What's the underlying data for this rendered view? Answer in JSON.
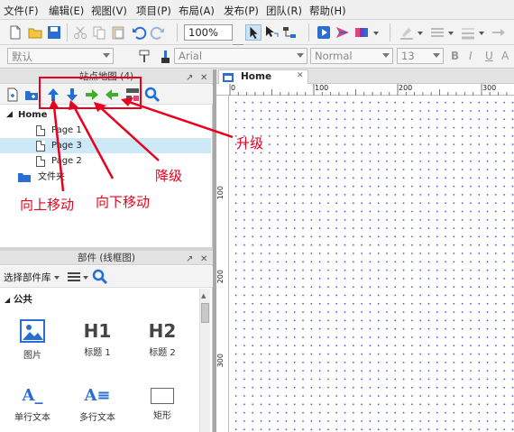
{
  "menu": {
    "items": [
      "文件(F)",
      "编辑(E)",
      "视图(V)",
      "项目(P)",
      "布局(A)",
      "发布(P)",
      "团队(R)",
      "帮助(H)"
    ]
  },
  "toolbar": {
    "zoom": "100%"
  },
  "format_bar": {
    "style_value": "默认",
    "font_value": "Arial",
    "weight_value": "Normal",
    "size_value": "13"
  },
  "sitemap": {
    "title": "站点地图 (4)",
    "home": "Home",
    "pages": [
      "Page 1",
      "Page 3",
      "Page 2"
    ],
    "folder": "文件夹"
  },
  "widgets": {
    "title": "部件 (线框图)",
    "library_select": "选择部件库",
    "section": "公共",
    "items": [
      {
        "glyph": "",
        "label": "图片"
      },
      {
        "glyph": "H1",
        "label": "标题 1"
      },
      {
        "glyph": "H2",
        "label": "标题 2"
      },
      {
        "glyph": "A_",
        "label": "单行文本"
      },
      {
        "glyph": "A≡",
        "label": "多行文本"
      },
      {
        "glyph": "",
        "label": "矩形"
      }
    ]
  },
  "canvas": {
    "tab": "Home",
    "h_ruler": [
      "0",
      "100",
      "200",
      "300"
    ],
    "v_ruler": [
      "100",
      "200",
      "300"
    ]
  },
  "annotations": {
    "promote": "升级",
    "demote": "降级",
    "move_up": "向上移动",
    "move_down": "向下移动"
  },
  "colors": {
    "annotation": "#e8001c",
    "arrow_blue": "#1e6fd9",
    "arrow_green": "#3fae2a",
    "selection": "#cde8f7"
  }
}
